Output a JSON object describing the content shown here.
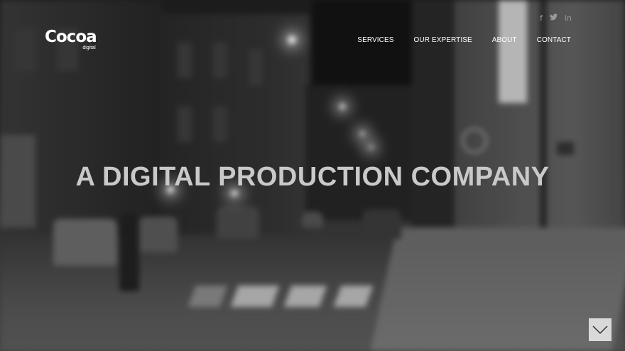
{
  "brand": {
    "name": "Cocoa",
    "tagline": "digital"
  },
  "social": [
    {
      "icon": "facebook-icon",
      "glyph": "f"
    },
    {
      "icon": "twitter-icon",
      "glyph": "🐦"
    },
    {
      "icon": "linkedin-icon",
      "glyph": "in"
    }
  ],
  "nav": {
    "services": "SERVICES",
    "expertise": "OUR EXPERTISE",
    "about": "ABOUT",
    "contact": "CONTACT"
  },
  "hero": {
    "headline": "A DIGITAL PRODUCTION COMPANY",
    "scroll_icon": "chevron-down-icon"
  },
  "colors": {
    "nav_text": "#ffffff",
    "headline": "#c9c9c9",
    "social_icons": "#9a9a9a",
    "scroll_button": "#d9d9d9"
  }
}
